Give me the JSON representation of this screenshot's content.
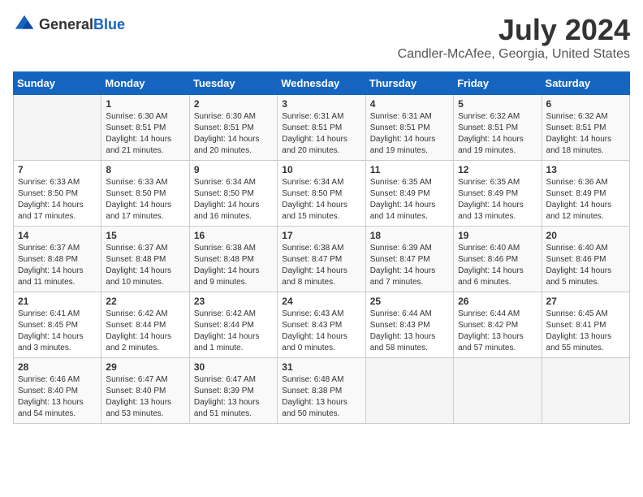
{
  "header": {
    "logo_general": "General",
    "logo_blue": "Blue",
    "month_year": "July 2024",
    "location": "Candler-McAfee, Georgia, United States"
  },
  "weekdays": [
    "Sunday",
    "Monday",
    "Tuesday",
    "Wednesday",
    "Thursday",
    "Friday",
    "Saturday"
  ],
  "weeks": [
    [
      {
        "day": "",
        "sunrise": "",
        "sunset": "",
        "daylight": ""
      },
      {
        "day": "1",
        "sunrise": "Sunrise: 6:30 AM",
        "sunset": "Sunset: 8:51 PM",
        "daylight": "Daylight: 14 hours and 21 minutes."
      },
      {
        "day": "2",
        "sunrise": "Sunrise: 6:30 AM",
        "sunset": "Sunset: 8:51 PM",
        "daylight": "Daylight: 14 hours and 20 minutes."
      },
      {
        "day": "3",
        "sunrise": "Sunrise: 6:31 AM",
        "sunset": "Sunset: 8:51 PM",
        "daylight": "Daylight: 14 hours and 20 minutes."
      },
      {
        "day": "4",
        "sunrise": "Sunrise: 6:31 AM",
        "sunset": "Sunset: 8:51 PM",
        "daylight": "Daylight: 14 hours and 19 minutes."
      },
      {
        "day": "5",
        "sunrise": "Sunrise: 6:32 AM",
        "sunset": "Sunset: 8:51 PM",
        "daylight": "Daylight: 14 hours and 19 minutes."
      },
      {
        "day": "6",
        "sunrise": "Sunrise: 6:32 AM",
        "sunset": "Sunset: 8:51 PM",
        "daylight": "Daylight: 14 hours and 18 minutes."
      }
    ],
    [
      {
        "day": "7",
        "sunrise": "Sunrise: 6:33 AM",
        "sunset": "Sunset: 8:50 PM",
        "daylight": "Daylight: 14 hours and 17 minutes."
      },
      {
        "day": "8",
        "sunrise": "Sunrise: 6:33 AM",
        "sunset": "Sunset: 8:50 PM",
        "daylight": "Daylight: 14 hours and 17 minutes."
      },
      {
        "day": "9",
        "sunrise": "Sunrise: 6:34 AM",
        "sunset": "Sunset: 8:50 PM",
        "daylight": "Daylight: 14 hours and 16 minutes."
      },
      {
        "day": "10",
        "sunrise": "Sunrise: 6:34 AM",
        "sunset": "Sunset: 8:50 PM",
        "daylight": "Daylight: 14 hours and 15 minutes."
      },
      {
        "day": "11",
        "sunrise": "Sunrise: 6:35 AM",
        "sunset": "Sunset: 8:49 PM",
        "daylight": "Daylight: 14 hours and 14 minutes."
      },
      {
        "day": "12",
        "sunrise": "Sunrise: 6:35 AM",
        "sunset": "Sunset: 8:49 PM",
        "daylight": "Daylight: 14 hours and 13 minutes."
      },
      {
        "day": "13",
        "sunrise": "Sunrise: 6:36 AM",
        "sunset": "Sunset: 8:49 PM",
        "daylight": "Daylight: 14 hours and 12 minutes."
      }
    ],
    [
      {
        "day": "14",
        "sunrise": "Sunrise: 6:37 AM",
        "sunset": "Sunset: 8:48 PM",
        "daylight": "Daylight: 14 hours and 11 minutes."
      },
      {
        "day": "15",
        "sunrise": "Sunrise: 6:37 AM",
        "sunset": "Sunset: 8:48 PM",
        "daylight": "Daylight: 14 hours and 10 minutes."
      },
      {
        "day": "16",
        "sunrise": "Sunrise: 6:38 AM",
        "sunset": "Sunset: 8:48 PM",
        "daylight": "Daylight: 14 hours and 9 minutes."
      },
      {
        "day": "17",
        "sunrise": "Sunrise: 6:38 AM",
        "sunset": "Sunset: 8:47 PM",
        "daylight": "Daylight: 14 hours and 8 minutes."
      },
      {
        "day": "18",
        "sunrise": "Sunrise: 6:39 AM",
        "sunset": "Sunset: 8:47 PM",
        "daylight": "Daylight: 14 hours and 7 minutes."
      },
      {
        "day": "19",
        "sunrise": "Sunrise: 6:40 AM",
        "sunset": "Sunset: 8:46 PM",
        "daylight": "Daylight: 14 hours and 6 minutes."
      },
      {
        "day": "20",
        "sunrise": "Sunrise: 6:40 AM",
        "sunset": "Sunset: 8:46 PM",
        "daylight": "Daylight: 14 hours and 5 minutes."
      }
    ],
    [
      {
        "day": "21",
        "sunrise": "Sunrise: 6:41 AM",
        "sunset": "Sunset: 8:45 PM",
        "daylight": "Daylight: 14 hours and 3 minutes."
      },
      {
        "day": "22",
        "sunrise": "Sunrise: 6:42 AM",
        "sunset": "Sunset: 8:44 PM",
        "daylight": "Daylight: 14 hours and 2 minutes."
      },
      {
        "day": "23",
        "sunrise": "Sunrise: 6:42 AM",
        "sunset": "Sunset: 8:44 PM",
        "daylight": "Daylight: 14 hours and 1 minute."
      },
      {
        "day": "24",
        "sunrise": "Sunrise: 6:43 AM",
        "sunset": "Sunset: 8:43 PM",
        "daylight": "Daylight: 14 hours and 0 minutes."
      },
      {
        "day": "25",
        "sunrise": "Sunrise: 6:44 AM",
        "sunset": "Sunset: 8:43 PM",
        "daylight": "Daylight: 13 hours and 58 minutes."
      },
      {
        "day": "26",
        "sunrise": "Sunrise: 6:44 AM",
        "sunset": "Sunset: 8:42 PM",
        "daylight": "Daylight: 13 hours and 57 minutes."
      },
      {
        "day": "27",
        "sunrise": "Sunrise: 6:45 AM",
        "sunset": "Sunset: 8:41 PM",
        "daylight": "Daylight: 13 hours and 55 minutes."
      }
    ],
    [
      {
        "day": "28",
        "sunrise": "Sunrise: 6:46 AM",
        "sunset": "Sunset: 8:40 PM",
        "daylight": "Daylight: 13 hours and 54 minutes."
      },
      {
        "day": "29",
        "sunrise": "Sunrise: 6:47 AM",
        "sunset": "Sunset: 8:40 PM",
        "daylight": "Daylight: 13 hours and 53 minutes."
      },
      {
        "day": "30",
        "sunrise": "Sunrise: 6:47 AM",
        "sunset": "Sunset: 8:39 PM",
        "daylight": "Daylight: 13 hours and 51 minutes."
      },
      {
        "day": "31",
        "sunrise": "Sunrise: 6:48 AM",
        "sunset": "Sunset: 8:38 PM",
        "daylight": "Daylight: 13 hours and 50 minutes."
      },
      {
        "day": "",
        "sunrise": "",
        "sunset": "",
        "daylight": ""
      },
      {
        "day": "",
        "sunrise": "",
        "sunset": "",
        "daylight": ""
      },
      {
        "day": "",
        "sunrise": "",
        "sunset": "",
        "daylight": ""
      }
    ]
  ]
}
